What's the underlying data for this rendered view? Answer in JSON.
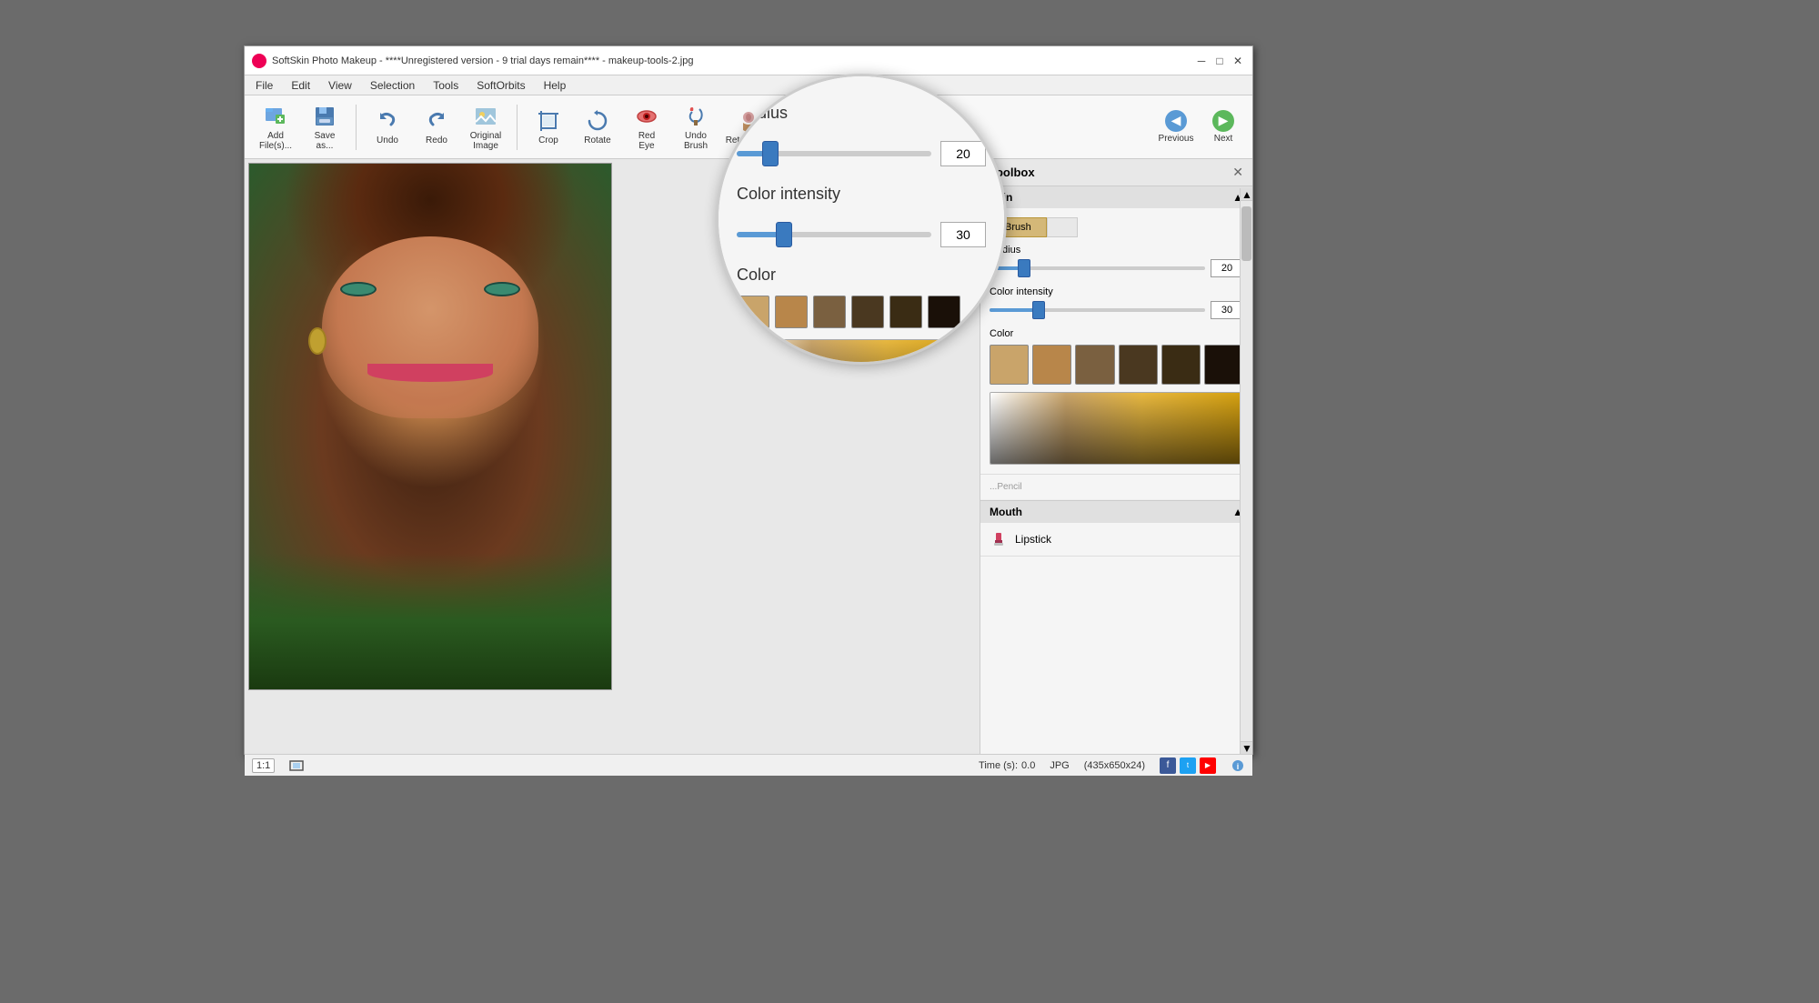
{
  "app": {
    "title": "SoftSkin Photo Makeup - ****Unregistered version - 9 trial days remain**** - makeup-tools-2.jpg",
    "icon": "🎨"
  },
  "titlebar": {
    "minimize": "─",
    "maximize": "□",
    "close": "✕"
  },
  "menu": {
    "items": [
      "File",
      "Edit",
      "View",
      "Selection",
      "Tools",
      "SoftOrbits",
      "Help"
    ]
  },
  "toolbar": {
    "add_files_label": "Add\nFile(s)...",
    "save_as_label": "Save\nas...",
    "undo_label": "Undo",
    "redo_label": "Redo",
    "original_image_label": "Original\nImage",
    "crop_label": "Crop",
    "rotate_label": "Rotate",
    "red_eye_label": "Red\nEye",
    "undo_brush_label": "Undo\nBrush",
    "retouching_label": "Retouching"
  },
  "nav": {
    "previous_label": "Previous",
    "next_label": "Next"
  },
  "toolbox": {
    "title": "Toolbox",
    "skin_section": "Skin",
    "tabs": [
      "Brush",
      ""
    ],
    "active_tab": "Brush",
    "radius_label": "Radius",
    "radius_value": "20",
    "radius_pct": 15,
    "color_intensity_label": "Color intensity",
    "color_intensity_value": "30",
    "color_intensity_pct": 22,
    "color_label": "Color",
    "swatches": [
      {
        "color": "#c9a46a",
        "name": "swatch-1"
      },
      {
        "color": "#b8864a",
        "name": "swatch-2"
      },
      {
        "color": "#7a6040",
        "name": "swatch-3"
      },
      {
        "color": "#4a3820",
        "name": "swatch-4"
      },
      {
        "color": "#3a2c14",
        "name": "swatch-5"
      },
      {
        "color": "#1a1008",
        "name": "swatch-6"
      }
    ],
    "mouth_section": "Mouth",
    "lipstick_label": "Lipstick"
  },
  "status": {
    "zoom": "1:1",
    "time_label": "Time (s):",
    "time_value": "0.0",
    "format": "JPG",
    "dimensions": "(435x650x24)"
  }
}
